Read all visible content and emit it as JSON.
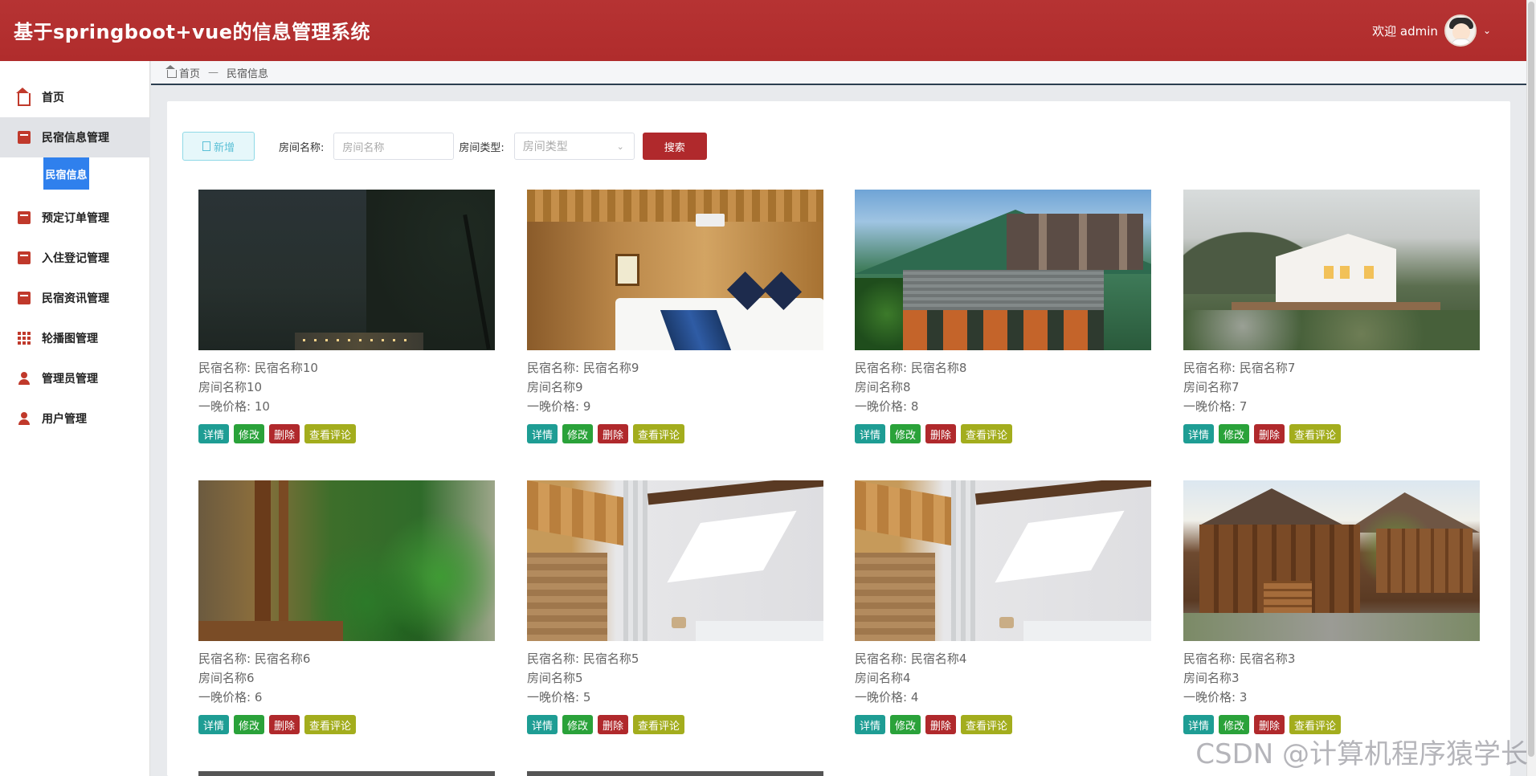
{
  "header": {
    "title": "基于springboot+vue的信息管理系统",
    "welcome": "欢迎 admin",
    "brand_color": "#b02c2c"
  },
  "sidebar": {
    "items": [
      {
        "label": "首页",
        "icon": "home-icon"
      },
      {
        "label": "民宿信息管理",
        "icon": "box-icon",
        "active": true
      },
      {
        "label": "预定订单管理",
        "icon": "box-icon"
      },
      {
        "label": "入住登记管理",
        "icon": "box-icon"
      },
      {
        "label": "民宿资讯管理",
        "icon": "box-icon"
      },
      {
        "label": "轮播图管理",
        "icon": "grid-icon"
      },
      {
        "label": "管理员管理",
        "icon": "user-icon"
      },
      {
        "label": "用户管理",
        "icon": "user-icon"
      }
    ],
    "sub_item": "民宿信息"
  },
  "breadcrumb": {
    "home": "首页",
    "separator": "—",
    "current": "民宿信息"
  },
  "toolbar": {
    "add_label": "新增",
    "room_name_label": "房间名称:",
    "room_name_placeholder": "房间名称",
    "room_type_label": "房间类型:",
    "room_type_placeholder": "房间类型",
    "search_label": "搜索"
  },
  "card_labels": {
    "name_prefix": "民宿名称:",
    "price_prefix": "一晚价格:",
    "detail": "详情",
    "edit": "修改",
    "delete": "删除",
    "comments": "查看评论"
  },
  "cards": [
    {
      "name": "民宿名称10",
      "room": "房间名称10",
      "price": "10"
    },
    {
      "name": "民宿名称9",
      "room": "房间名称9",
      "price": "9"
    },
    {
      "name": "民宿名称8",
      "room": "房间名称8",
      "price": "8"
    },
    {
      "name": "民宿名称7",
      "room": "房间名称7",
      "price": "7"
    },
    {
      "name": "民宿名称6",
      "room": "房间名称6",
      "price": "6"
    },
    {
      "name": "民宿名称5",
      "room": "房间名称5",
      "price": "5"
    },
    {
      "name": "民宿名称4",
      "room": "房间名称4",
      "price": "4"
    },
    {
      "name": "民宿名称3",
      "room": "房间名称3",
      "price": "3"
    }
  ],
  "watermark": "CSDN @计算机程序猿学长"
}
